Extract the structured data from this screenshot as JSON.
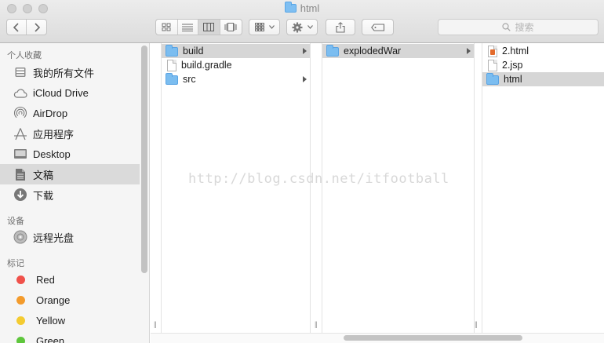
{
  "window": {
    "title": "html"
  },
  "toolbar": {
    "back_icon": "chevron-left-icon",
    "forward_icon": "chevron-right-icon",
    "view_modes": [
      "icon-view",
      "list-view",
      "column-view",
      "coverflow-view"
    ],
    "active_view": "column-view",
    "arrange_icon": "arrange-icon",
    "action_icon": "gear-icon",
    "share_icon": "share-icon",
    "tag_icon": "tag-icon",
    "search_placeholder": "搜索"
  },
  "sidebar": {
    "favorites_header": "个人收藏",
    "favorites": [
      {
        "label": "我的所有文件",
        "icon": "all-files-icon"
      },
      {
        "label": "iCloud Drive",
        "icon": "cloud-icon"
      },
      {
        "label": "AirDrop",
        "icon": "airdrop-icon"
      },
      {
        "label": "应用程序",
        "icon": "applications-icon"
      },
      {
        "label": "Desktop",
        "icon": "desktop-icon"
      },
      {
        "label": "文稿",
        "icon": "documents-icon",
        "selected": true
      },
      {
        "label": "下载",
        "icon": "download-icon"
      }
    ],
    "devices_header": "设备",
    "devices": [
      {
        "label": "远程光盘",
        "icon": "disc-icon"
      }
    ],
    "tags_header": "标记",
    "tags": [
      {
        "label": "Red",
        "color": "#f0514a"
      },
      {
        "label": "Orange",
        "color": "#f39b2c"
      },
      {
        "label": "Yellow",
        "color": "#f4cb31"
      },
      {
        "label": "Green",
        "color": "#5ec63c"
      }
    ]
  },
  "columns": [
    {
      "items": [
        {
          "name": "build",
          "type": "folder",
          "selected": true,
          "has_children": true
        },
        {
          "name": "build.gradle",
          "type": "file"
        },
        {
          "name": "src",
          "type": "folder",
          "has_children": true
        }
      ]
    },
    {
      "items": [
        {
          "name": "explodedWar",
          "type": "folder",
          "selected": true,
          "has_children": true
        }
      ]
    },
    {
      "items": [
        {
          "name": "2.html",
          "type": "html"
        },
        {
          "name": "2.jsp",
          "type": "file"
        },
        {
          "name": "html",
          "type": "folder",
          "selected": true
        }
      ]
    }
  ],
  "watermark": "http://blog.csdn.net/itfootball"
}
